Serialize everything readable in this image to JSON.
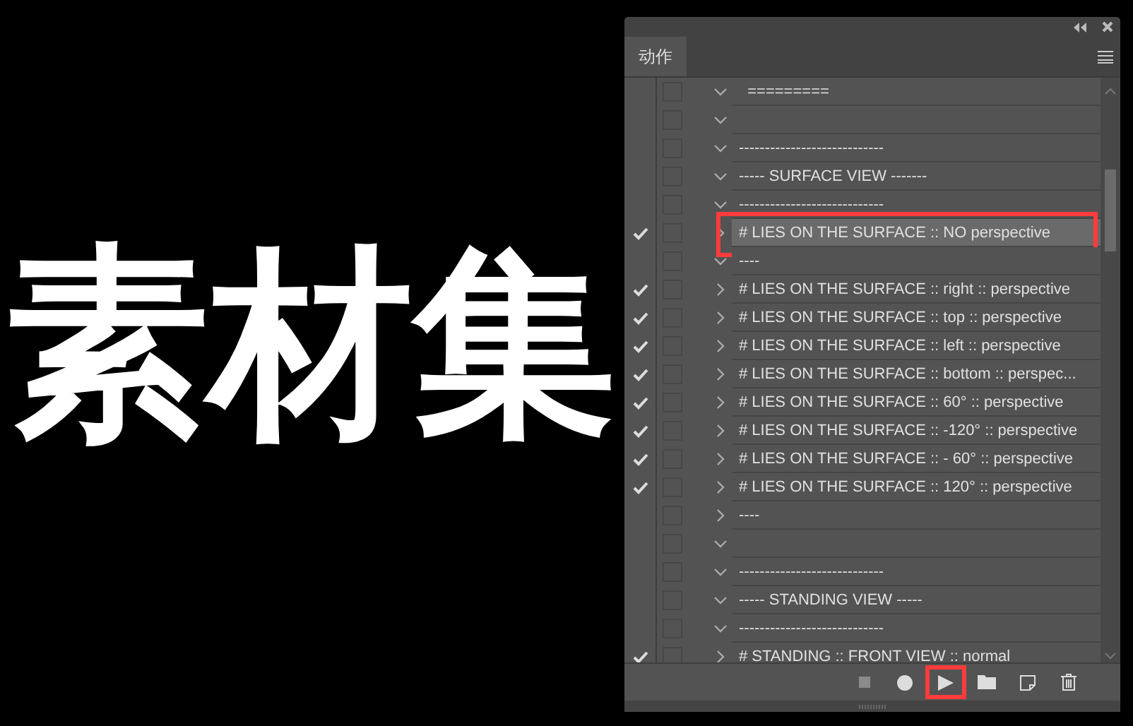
{
  "canvas": {
    "big_text": "素材集"
  },
  "panel": {
    "tab": {
      "label": "动作",
      "selected": true
    },
    "rows": [
      {
        "label": "  =========",
        "checked": false,
        "expanded": true,
        "selected": false,
        "highlighted": false
      },
      {
        "checked": false,
        "expanded": true,
        "selected": false,
        "highlighted": false
      },
      {
        "label": "----------------------------",
        "checked": false,
        "expanded": true,
        "selected": false,
        "highlighted": false
      },
      {
        "label": "----- SURFACE VIEW -------",
        "checked": false,
        "expanded": true,
        "selected": false,
        "highlighted": false
      },
      {
        "label": "----------------------------",
        "checked": false,
        "expanded": true,
        "selected": false,
        "highlighted": false
      },
      {
        "label": "# LIES ON THE SURFACE :: NO perspective",
        "checked": true,
        "expanded": false,
        "selected": true,
        "highlighted": true
      },
      {
        "label": "----",
        "checked": false,
        "expanded": true,
        "selected": false,
        "highlighted": false
      },
      {
        "label": "# LIES ON THE SURFACE :: right :: perspective",
        "checked": true,
        "expanded": false,
        "selected": false,
        "highlighted": false
      },
      {
        "label": "# LIES ON THE SURFACE :: top :: perspective",
        "checked": true,
        "expanded": false,
        "selected": false,
        "highlighted": false
      },
      {
        "label": "# LIES ON THE SURFACE :: left :: perspective",
        "checked": true,
        "expanded": false,
        "selected": false,
        "highlighted": false
      },
      {
        "label": "# LIES ON THE SURFACE :: bottom :: perspec...",
        "checked": true,
        "expanded": false,
        "selected": false,
        "highlighted": false
      },
      {
        "label": "# LIES ON THE SURFACE :: 60° :: perspective",
        "checked": true,
        "expanded": false,
        "selected": false,
        "highlighted": false
      },
      {
        "label": "# LIES ON THE SURFACE :: -120° :: perspective",
        "checked": true,
        "expanded": false,
        "selected": false,
        "highlighted": false
      },
      {
        "label": "# LIES ON THE SURFACE :: - 60° :: perspective",
        "checked": true,
        "expanded": false,
        "selected": false,
        "highlighted": false
      },
      {
        "label": "# LIES ON THE SURFACE :: 120° :: perspective",
        "checked": true,
        "expanded": false,
        "selected": false,
        "highlighted": false
      },
      {
        "label": "----",
        "checked": false,
        "expanded": false,
        "selected": false,
        "highlighted": false
      },
      {
        "checked": false,
        "expanded": true,
        "selected": false,
        "highlighted": false
      },
      {
        "label": "----------------------------",
        "checked": false,
        "expanded": true,
        "selected": false,
        "highlighted": false
      },
      {
        "label": "----- STANDING VIEW -----",
        "checked": false,
        "expanded": true,
        "selected": false,
        "highlighted": false
      },
      {
        "label": "----------------------------",
        "checked": false,
        "expanded": true,
        "selected": false,
        "highlighted": false
      },
      {
        "label": "# STANDING :: FRONT VIEW :: normal",
        "checked": true,
        "expanded": false,
        "selected": false,
        "highlighted": false
      }
    ],
    "footer_buttons": [
      {
        "kind": "stop",
        "highlighted": false
      },
      {
        "kind": "record",
        "highlighted": false
      },
      {
        "kind": "play",
        "highlighted": true
      },
      {
        "kind": "folder",
        "highlighted": false
      },
      {
        "kind": "new",
        "highlighted": false
      },
      {
        "kind": "trash",
        "highlighted": false
      }
    ]
  }
}
